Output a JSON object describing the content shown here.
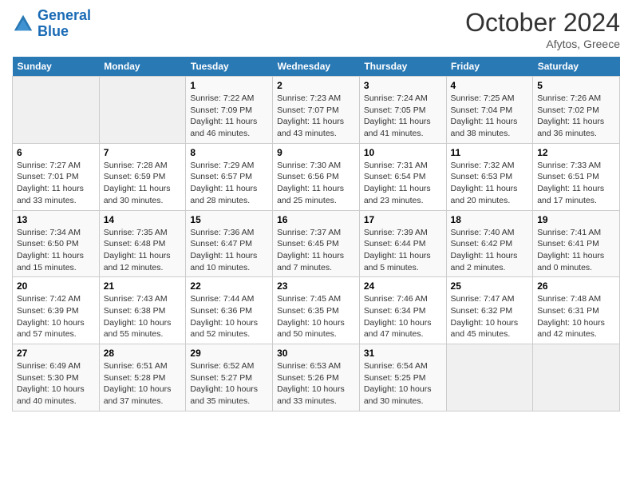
{
  "header": {
    "logo_line1": "General",
    "logo_line2": "Blue",
    "title": "October 2024",
    "subtitle": "Afytos, Greece"
  },
  "days_of_week": [
    "Sunday",
    "Monday",
    "Tuesday",
    "Wednesday",
    "Thursday",
    "Friday",
    "Saturday"
  ],
  "weeks": [
    [
      {
        "num": "",
        "sunrise": "",
        "sunset": "",
        "daylight": "",
        "empty": true
      },
      {
        "num": "",
        "sunrise": "",
        "sunset": "",
        "daylight": "",
        "empty": true
      },
      {
        "num": "1",
        "sunrise": "Sunrise: 7:22 AM",
        "sunset": "Sunset: 7:09 PM",
        "daylight": "Daylight: 11 hours and 46 minutes."
      },
      {
        "num": "2",
        "sunrise": "Sunrise: 7:23 AM",
        "sunset": "Sunset: 7:07 PM",
        "daylight": "Daylight: 11 hours and 43 minutes."
      },
      {
        "num": "3",
        "sunrise": "Sunrise: 7:24 AM",
        "sunset": "Sunset: 7:05 PM",
        "daylight": "Daylight: 11 hours and 41 minutes."
      },
      {
        "num": "4",
        "sunrise": "Sunrise: 7:25 AM",
        "sunset": "Sunset: 7:04 PM",
        "daylight": "Daylight: 11 hours and 38 minutes."
      },
      {
        "num": "5",
        "sunrise": "Sunrise: 7:26 AM",
        "sunset": "Sunset: 7:02 PM",
        "daylight": "Daylight: 11 hours and 36 minutes."
      }
    ],
    [
      {
        "num": "6",
        "sunrise": "Sunrise: 7:27 AM",
        "sunset": "Sunset: 7:01 PM",
        "daylight": "Daylight: 11 hours and 33 minutes."
      },
      {
        "num": "7",
        "sunrise": "Sunrise: 7:28 AM",
        "sunset": "Sunset: 6:59 PM",
        "daylight": "Daylight: 11 hours and 30 minutes."
      },
      {
        "num": "8",
        "sunrise": "Sunrise: 7:29 AM",
        "sunset": "Sunset: 6:57 PM",
        "daylight": "Daylight: 11 hours and 28 minutes."
      },
      {
        "num": "9",
        "sunrise": "Sunrise: 7:30 AM",
        "sunset": "Sunset: 6:56 PM",
        "daylight": "Daylight: 11 hours and 25 minutes."
      },
      {
        "num": "10",
        "sunrise": "Sunrise: 7:31 AM",
        "sunset": "Sunset: 6:54 PM",
        "daylight": "Daylight: 11 hours and 23 minutes."
      },
      {
        "num": "11",
        "sunrise": "Sunrise: 7:32 AM",
        "sunset": "Sunset: 6:53 PM",
        "daylight": "Daylight: 11 hours and 20 minutes."
      },
      {
        "num": "12",
        "sunrise": "Sunrise: 7:33 AM",
        "sunset": "Sunset: 6:51 PM",
        "daylight": "Daylight: 11 hours and 17 minutes."
      }
    ],
    [
      {
        "num": "13",
        "sunrise": "Sunrise: 7:34 AM",
        "sunset": "Sunset: 6:50 PM",
        "daylight": "Daylight: 11 hours and 15 minutes."
      },
      {
        "num": "14",
        "sunrise": "Sunrise: 7:35 AM",
        "sunset": "Sunset: 6:48 PM",
        "daylight": "Daylight: 11 hours and 12 minutes."
      },
      {
        "num": "15",
        "sunrise": "Sunrise: 7:36 AM",
        "sunset": "Sunset: 6:47 PM",
        "daylight": "Daylight: 11 hours and 10 minutes."
      },
      {
        "num": "16",
        "sunrise": "Sunrise: 7:37 AM",
        "sunset": "Sunset: 6:45 PM",
        "daylight": "Daylight: 11 hours and 7 minutes."
      },
      {
        "num": "17",
        "sunrise": "Sunrise: 7:39 AM",
        "sunset": "Sunset: 6:44 PM",
        "daylight": "Daylight: 11 hours and 5 minutes."
      },
      {
        "num": "18",
        "sunrise": "Sunrise: 7:40 AM",
        "sunset": "Sunset: 6:42 PM",
        "daylight": "Daylight: 11 hours and 2 minutes."
      },
      {
        "num": "19",
        "sunrise": "Sunrise: 7:41 AM",
        "sunset": "Sunset: 6:41 PM",
        "daylight": "Daylight: 11 hours and 0 minutes."
      }
    ],
    [
      {
        "num": "20",
        "sunrise": "Sunrise: 7:42 AM",
        "sunset": "Sunset: 6:39 PM",
        "daylight": "Daylight: 10 hours and 57 minutes."
      },
      {
        "num": "21",
        "sunrise": "Sunrise: 7:43 AM",
        "sunset": "Sunset: 6:38 PM",
        "daylight": "Daylight: 10 hours and 55 minutes."
      },
      {
        "num": "22",
        "sunrise": "Sunrise: 7:44 AM",
        "sunset": "Sunset: 6:36 PM",
        "daylight": "Daylight: 10 hours and 52 minutes."
      },
      {
        "num": "23",
        "sunrise": "Sunrise: 7:45 AM",
        "sunset": "Sunset: 6:35 PM",
        "daylight": "Daylight: 10 hours and 50 minutes."
      },
      {
        "num": "24",
        "sunrise": "Sunrise: 7:46 AM",
        "sunset": "Sunset: 6:34 PM",
        "daylight": "Daylight: 10 hours and 47 minutes."
      },
      {
        "num": "25",
        "sunrise": "Sunrise: 7:47 AM",
        "sunset": "Sunset: 6:32 PM",
        "daylight": "Daylight: 10 hours and 45 minutes."
      },
      {
        "num": "26",
        "sunrise": "Sunrise: 7:48 AM",
        "sunset": "Sunset: 6:31 PM",
        "daylight": "Daylight: 10 hours and 42 minutes."
      }
    ],
    [
      {
        "num": "27",
        "sunrise": "Sunrise: 6:49 AM",
        "sunset": "Sunset: 5:30 PM",
        "daylight": "Daylight: 10 hours and 40 minutes."
      },
      {
        "num": "28",
        "sunrise": "Sunrise: 6:51 AM",
        "sunset": "Sunset: 5:28 PM",
        "daylight": "Daylight: 10 hours and 37 minutes."
      },
      {
        "num": "29",
        "sunrise": "Sunrise: 6:52 AM",
        "sunset": "Sunset: 5:27 PM",
        "daylight": "Daylight: 10 hours and 35 minutes."
      },
      {
        "num": "30",
        "sunrise": "Sunrise: 6:53 AM",
        "sunset": "Sunset: 5:26 PM",
        "daylight": "Daylight: 10 hours and 33 minutes."
      },
      {
        "num": "31",
        "sunrise": "Sunrise: 6:54 AM",
        "sunset": "Sunset: 5:25 PM",
        "daylight": "Daylight: 10 hours and 30 minutes."
      },
      {
        "num": "",
        "sunrise": "",
        "sunset": "",
        "daylight": "",
        "empty": true
      },
      {
        "num": "",
        "sunrise": "",
        "sunset": "",
        "daylight": "",
        "empty": true
      }
    ]
  ]
}
